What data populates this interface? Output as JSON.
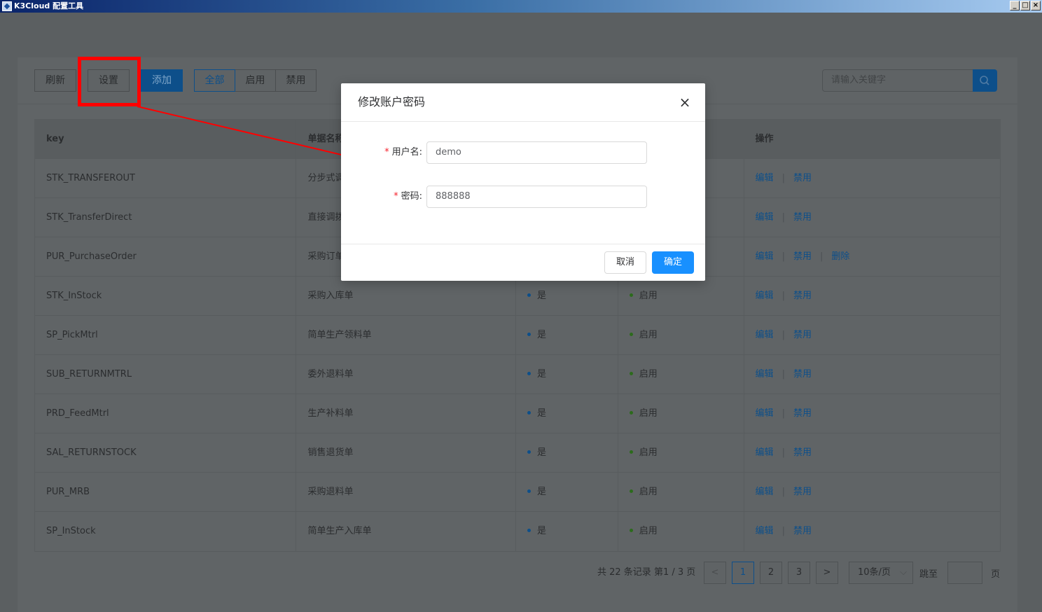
{
  "window": {
    "title": "K3Cloud 配置工具",
    "minimize": "_",
    "maximize": "□",
    "close": "×"
  },
  "toolbar": {
    "refresh_label": "刷新",
    "settings_label": "设置",
    "add_label": "添加",
    "filters": [
      "全部",
      "启用",
      "禁用"
    ],
    "active_filter": "全部",
    "search_placeholder": "请输入关键字"
  },
  "table": {
    "columns": [
      "key",
      "单据名称",
      "",
      "",
      "操作"
    ],
    "rows": [
      {
        "key": "STK_TRANSFEROUT",
        "name": "分步式调出单",
        "flag": "",
        "status": "",
        "actions": [
          "编辑",
          "禁用"
        ]
      },
      {
        "key": "STK_TransferDirect",
        "name": "直接调拨单",
        "flag": "",
        "status": "",
        "actions": [
          "编辑",
          "禁用"
        ]
      },
      {
        "key": "PUR_PurchaseOrder",
        "name": "采购订单",
        "flag": "",
        "status": "",
        "actions": [
          "编辑",
          "禁用",
          "删除"
        ]
      },
      {
        "key": "STK_InStock",
        "name": "采购入库单",
        "flag": "是",
        "status": "启用",
        "actions": [
          "编辑",
          "禁用"
        ]
      },
      {
        "key": "SP_PickMtrl",
        "name": "简单生产领料单",
        "flag": "是",
        "status": "启用",
        "actions": [
          "编辑",
          "禁用"
        ]
      },
      {
        "key": "SUB_RETURNMTRL",
        "name": "委外退料单",
        "flag": "是",
        "status": "启用",
        "actions": [
          "编辑",
          "禁用"
        ]
      },
      {
        "key": "PRD_FeedMtrl",
        "name": "生产补料单",
        "flag": "是",
        "status": "启用",
        "actions": [
          "编辑",
          "禁用"
        ]
      },
      {
        "key": "SAL_RETURNSTOCK",
        "name": "销售退货单",
        "flag": "是",
        "status": "启用",
        "actions": [
          "编辑",
          "禁用"
        ]
      },
      {
        "key": "PUR_MRB",
        "name": "采购退料单",
        "flag": "是",
        "status": "启用",
        "actions": [
          "编辑",
          "禁用"
        ]
      },
      {
        "key": "SP_InStock",
        "name": "简单生产入库单",
        "flag": "是",
        "status": "启用",
        "actions": [
          "编辑",
          "禁用"
        ]
      }
    ]
  },
  "pagination": {
    "total_text": "共 22 条记录 第1 / 3 页",
    "prev": "<",
    "next": ">",
    "pages": [
      "1",
      "2",
      "3"
    ],
    "current_page": "1",
    "page_size": "10条/页",
    "jump_label": "跳至",
    "page_suffix": "页"
  },
  "modal": {
    "title": "修改账户密码",
    "close": "×",
    "username_label": "用户名:",
    "username_value": "demo",
    "password_label": "密码:",
    "password_value": "888888",
    "required_mark": "*",
    "cancel_label": "取消",
    "ok_label": "确定"
  },
  "colors": {
    "primary": "#1890ff",
    "required": "#f5222d",
    "annotation": "#ff0000",
    "titlebar_start": "#0a246a"
  }
}
